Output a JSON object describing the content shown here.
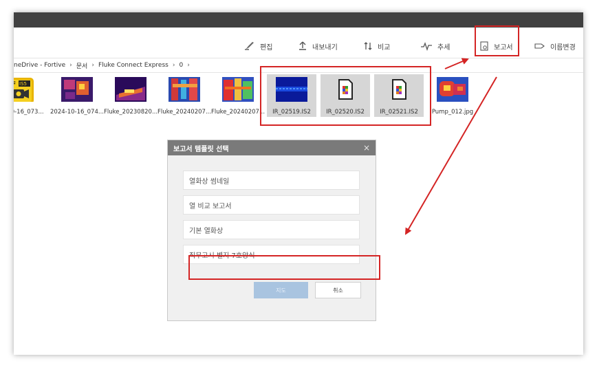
{
  "toolbar": {
    "edit_label": "편집",
    "export_label": "내보내기",
    "compare_label": "비교",
    "trend_label": "추세",
    "report_label": "보고서",
    "rename_label": "이름변경"
  },
  "breadcrumb": {
    "items": [
      "neDrive - Fortive",
      "문서",
      "Fluke Connect Express",
      "0"
    ],
    "separator": "›"
  },
  "files": [
    {
      "name": "24-10-16_073...",
      "thumb": "is5-icon",
      "selected": false
    },
    {
      "name": "2024-10-16_074...",
      "thumb": "thermal",
      "selected": false
    },
    {
      "name": "Fluke_20230820...",
      "thumb": "thermal",
      "selected": false
    },
    {
      "name": "Fluke_20240207...",
      "thumb": "thermal",
      "selected": false
    },
    {
      "name": "Fluke_20240207...",
      "thumb": "thermal",
      "selected": false
    },
    {
      "name": "IR_02519.IS2",
      "thumb": "thermal-blue",
      "selected": true
    },
    {
      "name": "IR_02520.IS2",
      "thumb": "document-icon",
      "selected": true
    },
    {
      "name": "IR_02521.IS2",
      "thumb": "document-icon",
      "selected": true
    },
    {
      "name": "Pump_012.jpg",
      "thumb": "thermal",
      "selected": false
    }
  ],
  "dialog": {
    "title": "보고서 템플릿 선택",
    "close": "×",
    "options": [
      "열화상 썸네일",
      "열 비교 보고서",
      "기본 열화상",
      "직무고시 별지 7호양식"
    ],
    "ok_label": "지도",
    "cancel_label": "취소"
  },
  "colors": {
    "annotation": "#d42424",
    "titlebar": "#404040",
    "dialog_header": "#7a7a7a",
    "ok_disabled": "#a9c4e0"
  }
}
